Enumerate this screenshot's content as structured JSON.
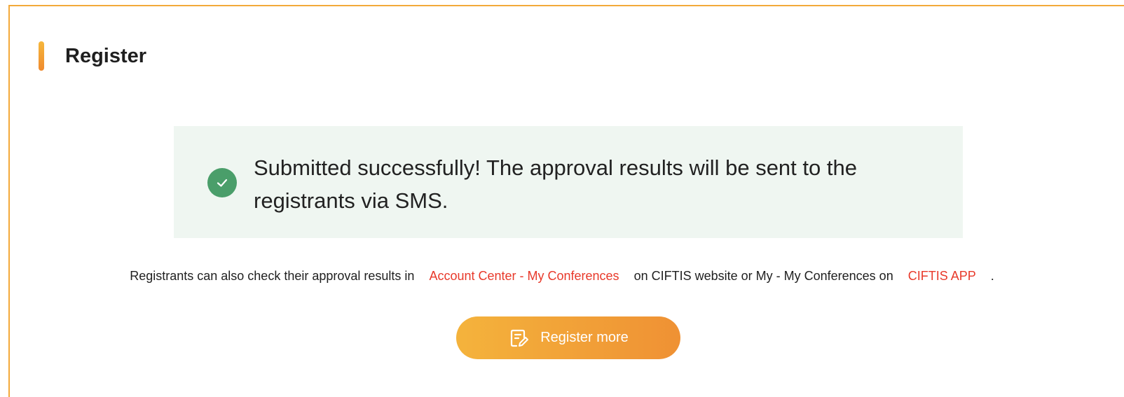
{
  "section": {
    "title": "Register"
  },
  "success": {
    "message": "Submitted successfully! The approval results will be sent to the registrants via SMS.",
    "icon": "check-circle-icon",
    "icon_color": "#4a9e6a",
    "panel_color": "#eff6f1"
  },
  "info": {
    "part1": "Registrants can also check their approval results in",
    "link1": "Account Center - My Conferences",
    "part2": "on CIFTIS website or My - My Conferences on",
    "link2": "CIFTIS APP",
    "part3": ".",
    "link_color": "#e8392a"
  },
  "actions": {
    "register_more_label": "Register more",
    "register_more_icon": "edit-document-icon"
  },
  "colors": {
    "accent": "#f3a93a",
    "text": "#1f1f1f"
  }
}
